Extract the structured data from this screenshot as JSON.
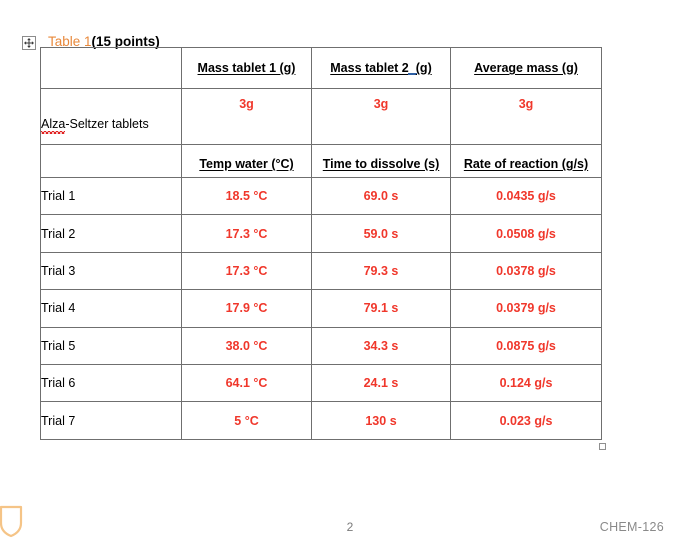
{
  "caption": {
    "label": "Table 1",
    "points": "(15 points)"
  },
  "icons": {
    "move_handle": "table-move-handle-icon",
    "resize_handle": "table-resize-handle-icon",
    "shield": "shield-icon"
  },
  "table": {
    "header_row_1": {
      "label": "",
      "columns": [
        "Mass tablet 1 (g)",
        "Mass tablet 2  (g)",
        "Average mass (g)"
      ],
      "col2_prefix": "Mass tablet 2",
      "col2_suffix": "(g)"
    },
    "mass_row": {
      "label": "Alza-Seltzer tablets",
      "label_misspelled": "Alza",
      "label_rest": "-Seltzer tablets",
      "values": [
        "3g",
        "3g",
        "3g"
      ]
    },
    "header_row_2": {
      "label": "",
      "columns": [
        "Temp water (°C)",
        "Time to dissolve (s)",
        "Rate of reaction (g/s)"
      ]
    },
    "rows": [
      {
        "label": "Trial 1",
        "temp": "18.5 °C",
        "time": "69.0 s",
        "rate": "0.0435 g/s"
      },
      {
        "label": "Trial 2",
        "temp": "17.3 °C",
        "time": "59.0 s",
        "rate": "0.0508 g/s"
      },
      {
        "label": "Trial 3",
        "temp": "17.3 °C",
        "time": "79.3 s",
        "rate": "0.0378 g/s"
      },
      {
        "label": "Trial 4",
        "temp": "17.9 °C",
        "time": "79.1 s",
        "rate": "0.0379 g/s"
      },
      {
        "label": "Trial 5",
        "temp": "38.0 °C",
        "time": "34.3 s",
        "rate": "0.0875 g/s"
      },
      {
        "label": "Trial 6",
        "temp": "64.1 °C",
        "time": "24.1 s",
        "rate": "0.124 g/s"
      },
      {
        "label": "Trial 7",
        "temp": "5 °C",
        "time": "130 s",
        "rate": "0.023 g/s"
      }
    ]
  },
  "footer": {
    "page_number": "2",
    "course": "CHEM-126"
  },
  "colors": {
    "caption_orange": "#E8883A",
    "data_red": "#F0372B",
    "border_gray": "#6f6f6f",
    "footer_gray": "#8a8a8a",
    "shield_orange": "#F5C487",
    "tracked_change_blue": "#2E5FA3"
  }
}
